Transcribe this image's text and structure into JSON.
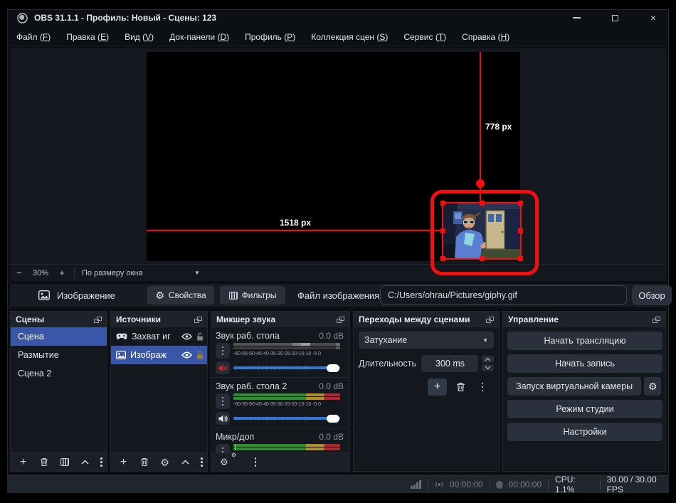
{
  "window": {
    "title": "OBS 31.1.1 - Профиль: Новый - Сцены: 123"
  },
  "icons": {
    "close": "×",
    "gear": "⚙",
    "plus": "+",
    "minus": "−",
    "caret_down": "▼"
  },
  "menu": {
    "items": [
      {
        "pre": "Файл (",
        "key": "F",
        "post": ")"
      },
      {
        "pre": "Правка (",
        "key": "E",
        "post": ")"
      },
      {
        "pre": "Вид (",
        "key": "V",
        "post": ")"
      },
      {
        "pre": "Док-панели (",
        "key": "D",
        "post": ")"
      },
      {
        "pre": "Профиль (",
        "key": "P",
        "post": ")"
      },
      {
        "pre": "Коллекция сцен (",
        "key": "S",
        "post": ")"
      },
      {
        "pre": "Сервис (",
        "key": "T",
        "post": ")"
      },
      {
        "pre": "Справка (",
        "key": "H",
        "post": ")"
      }
    ]
  },
  "preview": {
    "zoom_level": "30%",
    "fit_label": "По размеру окна",
    "width_annotation": "1518 px",
    "height_annotation": "778 px",
    "annotation_color": "#f70d0d"
  },
  "source_toolbar": {
    "source_type_label": "Изображение",
    "properties_label": "Свойства",
    "filters_label": "Фильтры",
    "file_label": "Файл изображения",
    "file_path": "C:/Users/ohrau/Pictures/giphy.gif",
    "browse_label": "Обзор"
  },
  "scenes": {
    "title": "Сцены",
    "items": [
      {
        "label": "Сцена",
        "selected": true
      },
      {
        "label": "Размытие",
        "selected": false
      },
      {
        "label": "Сцена 2",
        "selected": false
      }
    ]
  },
  "sources": {
    "title": "Источники",
    "items": [
      {
        "label": "Захват иг",
        "icon": "game-capture",
        "selected": false
      },
      {
        "label": "Изображ",
        "icon": "image",
        "selected": true
      }
    ]
  },
  "mixer": {
    "title": "Микшер звука",
    "scale_text": "-60-55-50-45-40-35-30-25-20-15-10 -5 0",
    "channels": [
      {
        "name": "Звук раб. стола",
        "db": "0.0 dB",
        "muted": true
      },
      {
        "name": "Звук раб. стола 2",
        "db": "0.0 dB",
        "muted": false
      },
      {
        "name": "Микр/доп",
        "db": "0.0 dB",
        "muted": false
      }
    ],
    "colors": {
      "green": "#2e8f2e",
      "yellow": "#b08f2a",
      "red": "#b2262e",
      "slider": "#2e79d8"
    }
  },
  "transitions": {
    "title": "Переходы между сценами",
    "transition_value": "Затухание",
    "duration_label": "Длительность",
    "duration_value": "300 ms"
  },
  "controls": {
    "title": "Управление",
    "buttons": [
      "Начать трансляцию",
      "Начать запись",
      "Запуск виртуальной камеры",
      "Режим студии",
      "Настройки"
    ]
  },
  "statusbar": {
    "stream_time": "00:00:00",
    "record_time": "00:00:00",
    "cpu": "CPU: 1.1%",
    "fps": "30.00 / 30.00 FPS"
  },
  "colors": {
    "selection_blue": "#3a56a8",
    "panel_bg": "#14171d",
    "window_bg": "#0c0f14"
  }
}
